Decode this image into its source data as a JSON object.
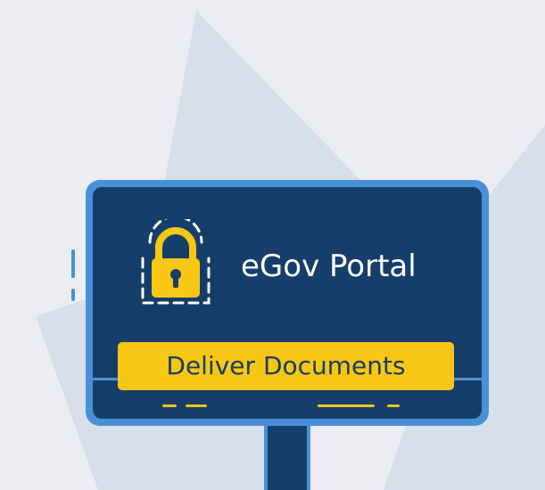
{
  "portal": {
    "title": "eGov Portal"
  },
  "actions": {
    "deliver_label": "Deliver Documents"
  },
  "icons": {
    "lock": "padlock-icon"
  },
  "colors": {
    "background": "#ebedf2",
    "background_shape": "#d6dfea",
    "monitor_frame": "#4a90d6",
    "monitor_screen": "#163e6b",
    "accent": "#f8c713",
    "button_text": "#1b3d66",
    "title_text": "#ffffff"
  }
}
